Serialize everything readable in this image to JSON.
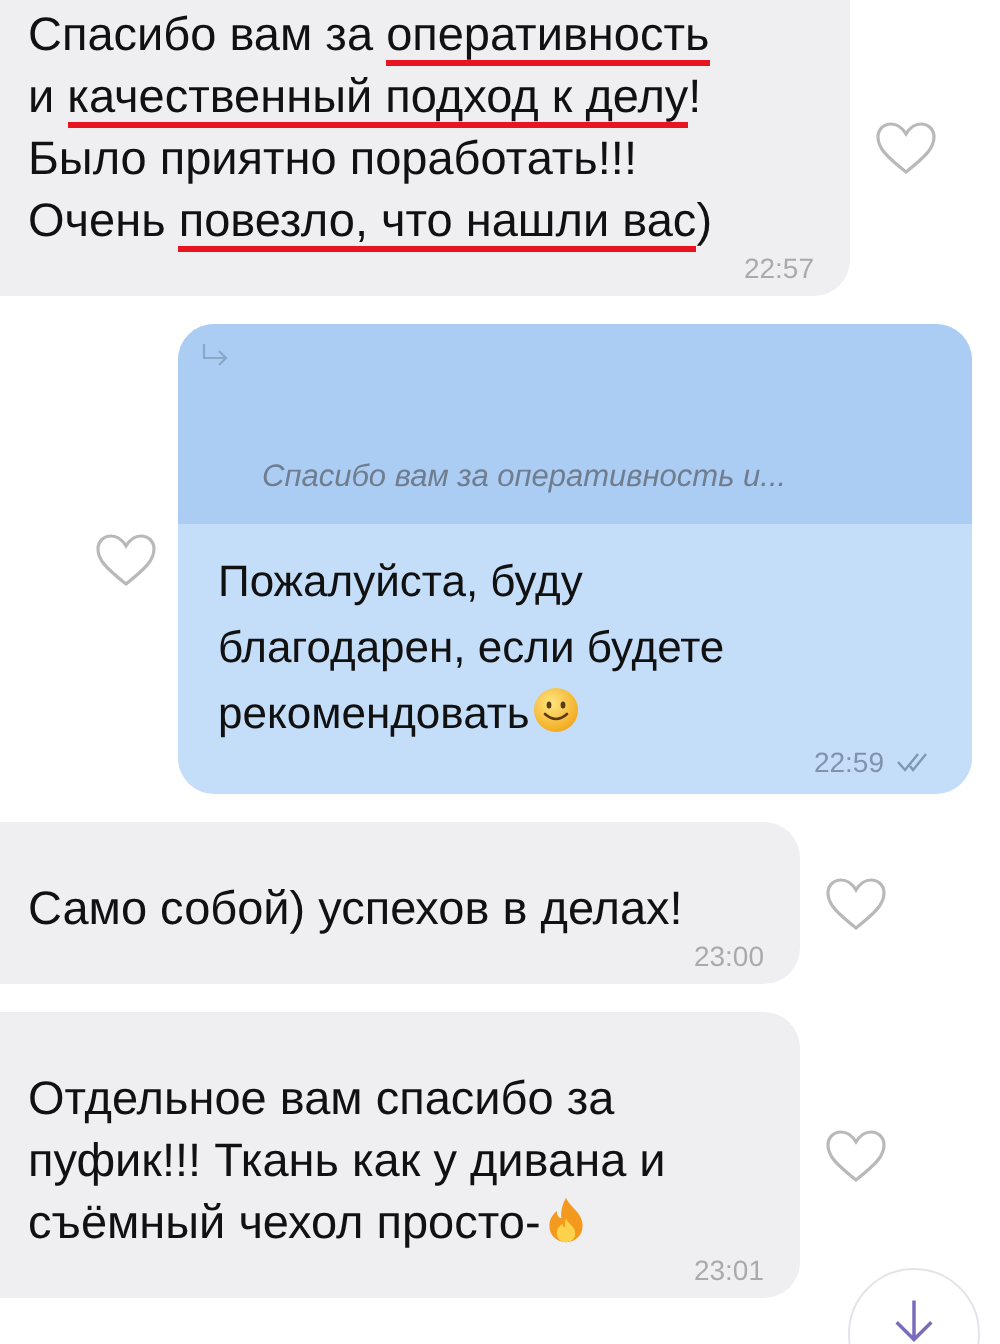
{
  "messages": [
    {
      "kind": "incoming",
      "liked": false,
      "time": "22:57",
      "lines": [
        [
          {
            "kind": "text",
            "text": "Спасибо вам за ",
            "underlined": false
          },
          {
            "kind": "text",
            "text": "оперативность",
            "underlined": true
          }
        ],
        [
          {
            "kind": "text",
            "text": "и ",
            "underlined": false
          },
          {
            "kind": "text",
            "text": "качественный подход к делу",
            "underlined": true
          },
          {
            "kind": "text",
            "text": "!",
            "underlined": false
          }
        ],
        [
          {
            "kind": "text",
            "text": "Было приятно поработать!!!",
            "underlined": false
          }
        ],
        [
          {
            "kind": "text",
            "text": "Очень ",
            "underlined": false
          },
          {
            "kind": "text",
            "text": "повезло, что нашли вас",
            "underlined": true
          },
          {
            "kind": "text",
            "text": ")",
            "underlined": false
          }
        ]
      ]
    },
    {
      "kind": "outgoing",
      "liked": false,
      "time": "22:59",
      "read": true,
      "quote": "Спасибо вам за оперативность и...",
      "lines": [
        [
          {
            "kind": "text",
            "text": "Пожалуйста, буду"
          }
        ],
        [
          {
            "kind": "text",
            "text": "благодарен, если будете"
          }
        ],
        [
          {
            "kind": "text",
            "text": "рекомендовать"
          },
          {
            "kind": "smile"
          }
        ]
      ]
    },
    {
      "kind": "incoming",
      "liked": false,
      "time": "23:00",
      "lines": [
        [
          {
            "kind": "text",
            "text": "Само собой) успехов в делах!"
          }
        ]
      ]
    },
    {
      "kind": "incoming",
      "liked": false,
      "time": "23:01",
      "lines": [
        [
          {
            "kind": "text",
            "text": "Отдельное вам спасибо за"
          }
        ],
        [
          {
            "kind": "text",
            "text": "пуфик!!! Ткань как у дивана и"
          }
        ],
        [
          {
            "kind": "text",
            "text": "съёмный чехол просто-"
          },
          {
            "kind": "fire"
          }
        ]
      ]
    }
  ]
}
